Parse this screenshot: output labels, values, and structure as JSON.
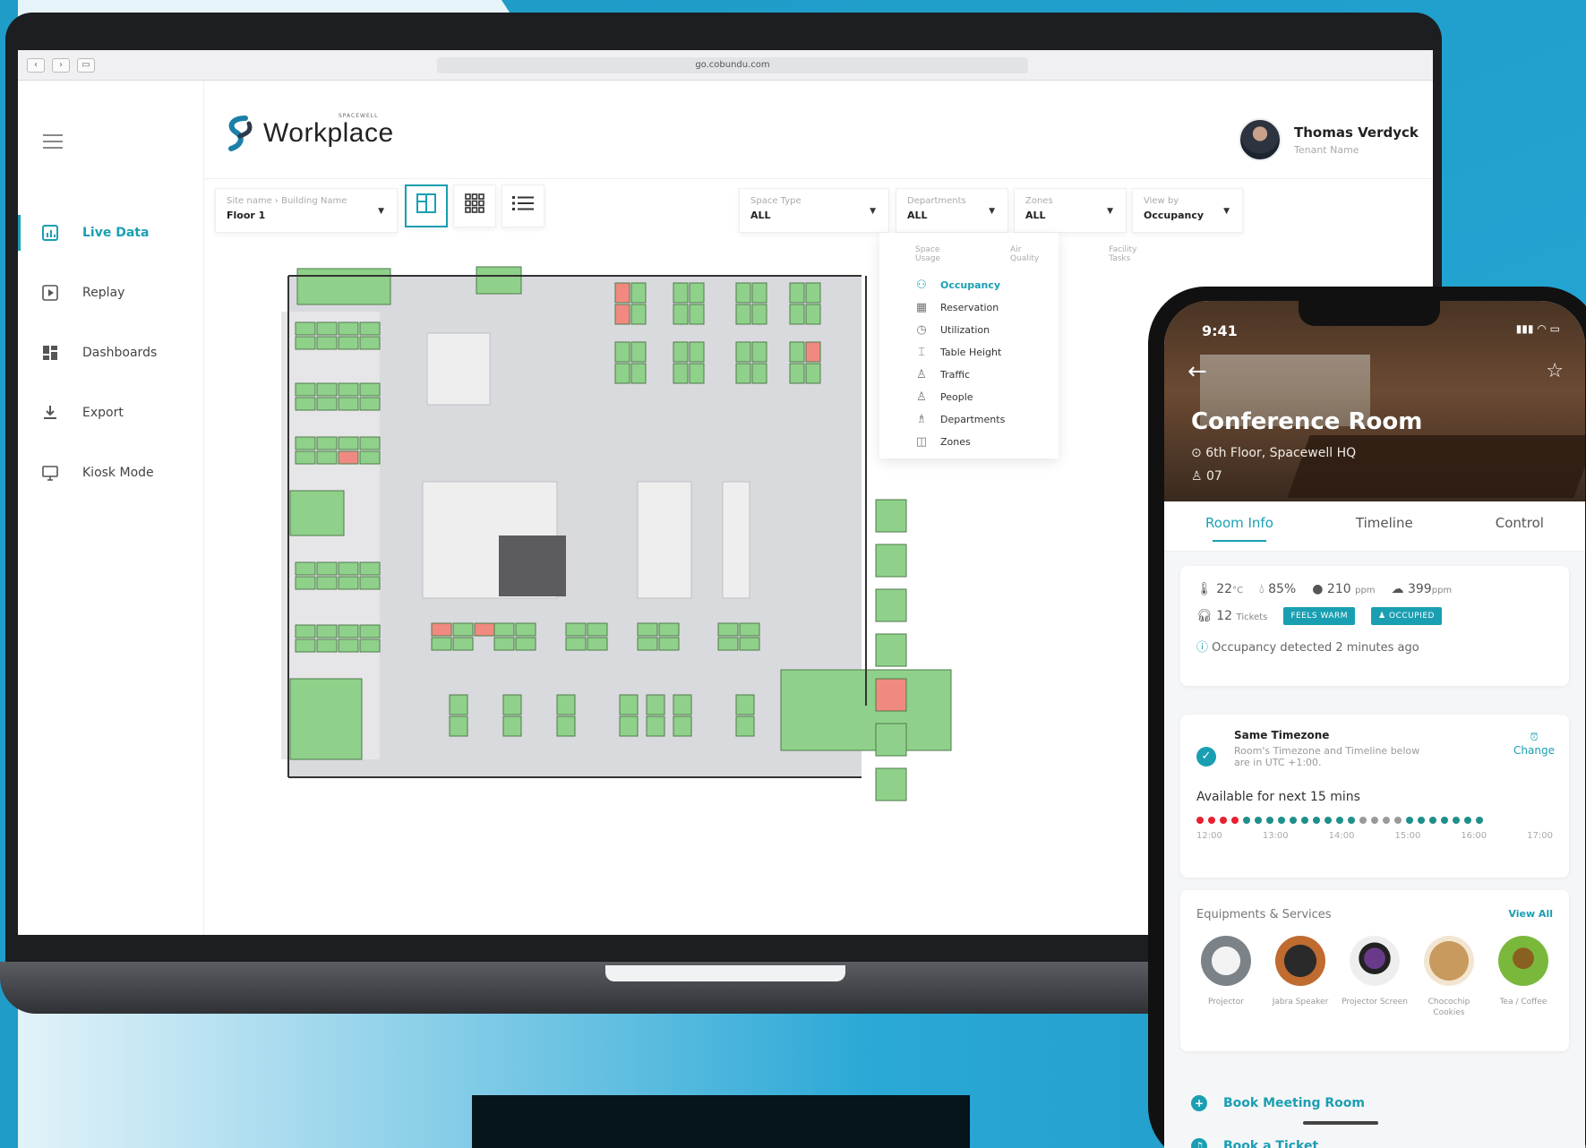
{
  "browser": {
    "url": "go.cobundu.com"
  },
  "sidebar": {
    "items": [
      {
        "label": "Live Data",
        "icon": "bar-chart-icon",
        "active": true
      },
      {
        "label": "Replay",
        "icon": "play-icon",
        "active": false
      },
      {
        "label": "Dashboards",
        "icon": "dashboard-icon",
        "active": false
      },
      {
        "label": "Export",
        "icon": "download-icon",
        "active": false
      },
      {
        "label": "Kiosk Mode",
        "icon": "monitor-icon",
        "active": false
      }
    ]
  },
  "header": {
    "logo_text": "Workplace",
    "logo_sub": "SPACEWELL",
    "user_name": "Thomas Verdyck",
    "user_role": "Tenant Name"
  },
  "toolbar": {
    "site": {
      "label": "Site name › Building Name",
      "value": "Floor 1"
    },
    "space_type": {
      "label": "Space Type",
      "value": "ALL"
    },
    "departments": {
      "label": "Departments",
      "value": "ALL"
    },
    "zones": {
      "label": "Zones",
      "value": "ALL"
    },
    "view_by": {
      "label": "View by",
      "value": "Occupancy"
    }
  },
  "menu": {
    "headers": [
      "Space Usage",
      "Air Quality",
      "Facility Tasks"
    ],
    "items": [
      {
        "label": "Occupancy",
        "active": true
      },
      {
        "label": "Reservation",
        "active": false
      },
      {
        "label": "Utilization",
        "active": false
      },
      {
        "label": "Table Height",
        "active": false
      },
      {
        "label": "Traffic",
        "active": false
      },
      {
        "label": "People",
        "active": false
      },
      {
        "label": "Departments",
        "active": false
      },
      {
        "label": "Zones",
        "active": false
      }
    ]
  },
  "phone": {
    "time": "9:41",
    "room_title": "Conference Room",
    "location": "6th Floor, Spacewell HQ",
    "capacity": "07",
    "tabs": [
      "Room Info",
      "Timeline",
      "Control"
    ],
    "env": {
      "temp": "22",
      "temp_unit": "°C",
      "humidity": "85%",
      "co2": "210",
      "co2_unit": "ppm",
      "voc": "399",
      "voc_unit": "ppm",
      "tickets": "12",
      "tickets_label": "Tickets",
      "badge_warm": "FEELS WARM",
      "badge_occupied": "OCCUPIED",
      "note": "Occupancy detected 2 minutes ago"
    },
    "timezone": {
      "title": "Same Timezone",
      "desc": "Room's Timezone and Timeline below are in UTC +1:00.",
      "change": "Change",
      "available": "Available for next 15 mins",
      "ticks": [
        "12:00",
        "13:00",
        "14:00",
        "15:00",
        "16:00",
        "17:00"
      ],
      "slots": [
        "busy",
        "busy",
        "busy",
        "busy",
        "free",
        "free",
        "free",
        "free",
        "free",
        "free",
        "free",
        "free",
        "free",
        "free",
        "off",
        "off",
        "off",
        "off",
        "free",
        "free",
        "free",
        "free",
        "free",
        "free",
        "free"
      ]
    },
    "equipment": {
      "title": "Equipments & Services",
      "view_all": "View All",
      "items": [
        "Projector",
        "Jabra Speaker",
        "Projector Screen",
        "Chocochip Cookies",
        "Tea / Coffee"
      ]
    },
    "actions": [
      "Book Meeting Room",
      "Book a Ticket"
    ]
  },
  "colors": {
    "accent": "#1a9fb2",
    "busy": "#e8202f",
    "free": "#1f8f8a",
    "off": "#9a9a9a",
    "desk_free": "#8fd18a",
    "desk_busy": "#f08a80"
  }
}
